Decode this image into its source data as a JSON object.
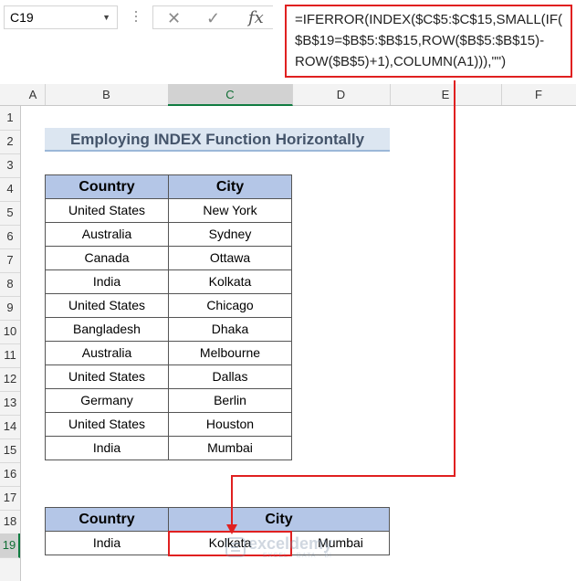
{
  "formula_bar": {
    "name_box": "C19",
    "formula_lines": [
      "=IFERROR(INDEX($C$5:$C$15,SMALL(IF(",
      "$B$19=$B$5:$B$15,ROW($B$5:$B$15)-",
      "ROW($B$5)+1),COLUMN(A1))),\"\")"
    ],
    "cancel_glyph": "✕",
    "enter_glyph": "✓",
    "fx_glyph": "fx"
  },
  "columns": [
    "A",
    "B",
    "C",
    "D",
    "E",
    "F"
  ],
  "rows": [
    "1",
    "2",
    "3",
    "4",
    "5",
    "6",
    "7",
    "8",
    "9",
    "10",
    "11",
    "12",
    "13",
    "14",
    "15",
    "16",
    "17",
    "18",
    "19"
  ],
  "selected_cell": {
    "column": "C",
    "row": "19"
  },
  "title": "Employing INDEX Function Horizontally",
  "source_table": {
    "headers": [
      "Country",
      "City"
    ],
    "rows": [
      [
        "United States",
        "New York"
      ],
      [
        "Australia",
        "Sydney"
      ],
      [
        "Canada",
        "Ottawa"
      ],
      [
        "India",
        "Kolkata"
      ],
      [
        "United States",
        "Chicago"
      ],
      [
        "Bangladesh",
        "Dhaka"
      ],
      [
        "Australia",
        "Melbourne"
      ],
      [
        "United States",
        "Dallas"
      ],
      [
        "Germany",
        "Berlin"
      ],
      [
        "United States",
        "Houston"
      ],
      [
        "India",
        "Mumbai"
      ]
    ]
  },
  "result_table": {
    "headers": [
      "Country",
      "City"
    ],
    "row": [
      "India",
      "Kolkata",
      "Mumbai"
    ]
  },
  "watermark": {
    "name": "exceldemy",
    "tagline": "EXCEL · DATA · BI"
  },
  "colors": {
    "accent_red": "#e02020",
    "header_fill": "#b4c6e7",
    "title_fill": "#dce6f1",
    "excel_green": "#107c41"
  }
}
